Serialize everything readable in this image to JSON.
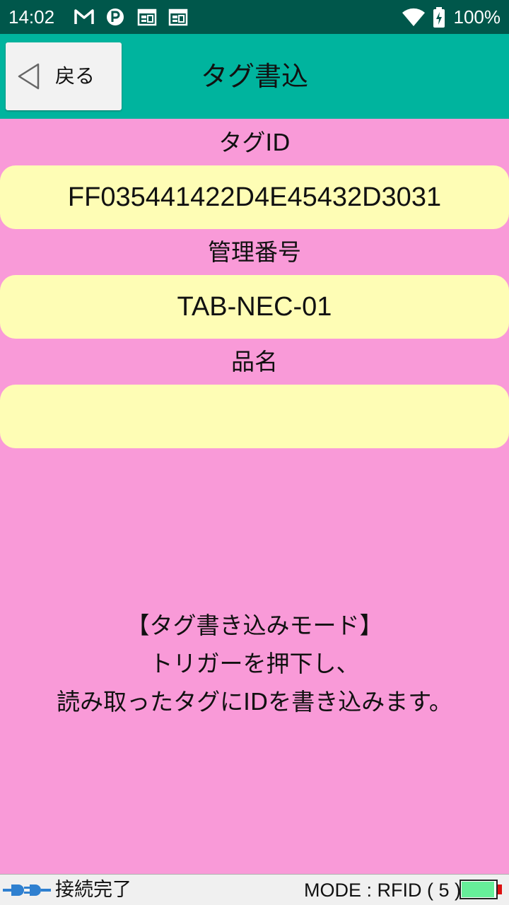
{
  "status_bar": {
    "time": "14:02",
    "battery_percent": "100%",
    "icons": [
      "gmail-icon",
      "parking-icon",
      "calendar-icon",
      "calendar-icon",
      "wifi-icon",
      "battery-charging-icon"
    ]
  },
  "app_bar": {
    "back_label": "戻る",
    "title": "タグ書込"
  },
  "form": {
    "tag_id_label": "タグID",
    "tag_id_value": "FF035441422D4E45432D3031",
    "management_no_label": "管理番号",
    "management_no_value": "TAB-NEC-01",
    "item_name_label": "品名",
    "item_name_value": ""
  },
  "message": {
    "line1": "【タグ書き込みモード】",
    "line2": "トリガーを押下し、",
    "line3": "読み取ったタグにIDを書き込みます。"
  },
  "bottom_bar": {
    "connection_status": "接続完了",
    "mode": "MODE : RFID ( 5 )",
    "reader_battery_level": 0.95
  },
  "colors": {
    "status_bar": "#00574b",
    "app_bar": "#00b49e",
    "background": "#f99ad8",
    "field": "#fefdb5",
    "battery_fill": "#66ee99"
  }
}
